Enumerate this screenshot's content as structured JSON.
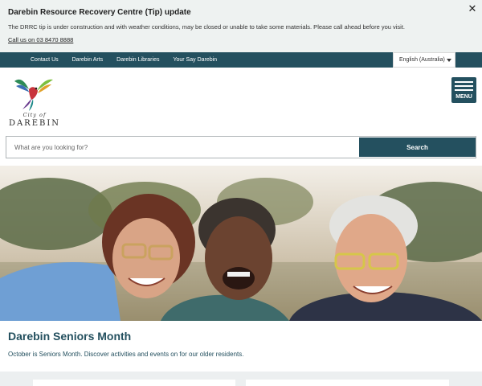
{
  "alert": {
    "title": "Darebin Resource Recovery Centre (Tip) update",
    "text": "The DRRC tip is under construction and with weather conditions, may be closed or unable to take some materials. Please call ahead before you visit.",
    "link": "Call us on 03 8470 8888",
    "close_icon": "close-icon"
  },
  "utility_nav": {
    "links": [
      "Contact Us",
      "Darebin Arts",
      "Darebin Libraries",
      "Your Say Darebin"
    ],
    "language": "English (Australia)"
  },
  "logo": {
    "city": "City of",
    "name": "DAREBIN"
  },
  "menu": {
    "label": "MENU",
    "icon": "hamburger-icon"
  },
  "search": {
    "placeholder": "What are you looking for?",
    "button_label": "Search"
  },
  "feature": {
    "title": "Darebin Seniors Month",
    "text": "October is Seniors Month. Discover activities and events on for our older residents."
  },
  "colors": {
    "brand": "#24505f",
    "alert_bg": "#eef2f1"
  }
}
